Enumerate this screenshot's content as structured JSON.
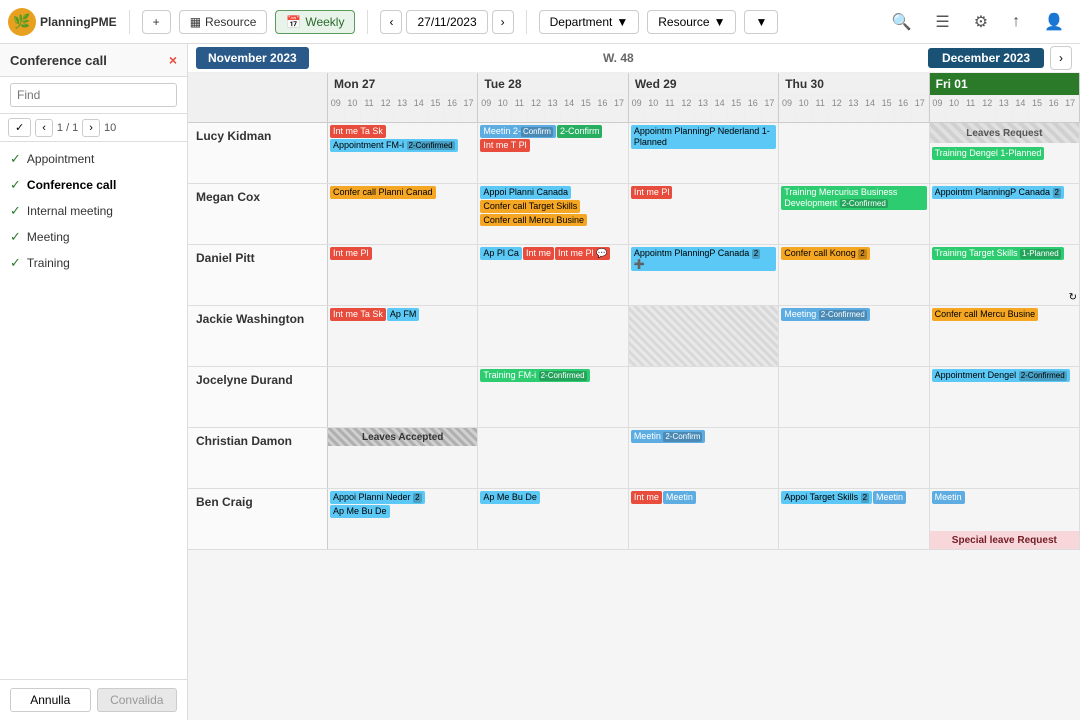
{
  "app": {
    "logo_text": "PlanningPME",
    "logo_icon": "🌿"
  },
  "toolbar": {
    "add_label": "+",
    "resource_label": "Resource",
    "weekly_label": "Weekly",
    "date_value": "27/11/2023",
    "department_label": "Department",
    "resource_filter_label": "Resource",
    "filter_icon": "▼",
    "search_icon": "🔍",
    "layers_icon": "☰",
    "settings_icon": "⚙",
    "share_icon": "↑",
    "user_icon": "👤"
  },
  "sidebar": {
    "title": "Conference call",
    "close_icon": "×",
    "find_placeholder": "Find",
    "nav_prev": "‹",
    "nav_next": "›",
    "nav_info": "1 / 1",
    "nav_max": "10",
    "filters": [
      {
        "id": "appointment",
        "label": "Appointment",
        "checked": true
      },
      {
        "id": "conference-call",
        "label": "Conference call",
        "checked": true,
        "active": true
      },
      {
        "id": "internal-meeting",
        "label": "Internal meeting",
        "checked": true
      },
      {
        "id": "meeting",
        "label": "Meeting",
        "checked": true
      },
      {
        "id": "training",
        "label": "Training",
        "checked": true
      }
    ],
    "btn_annulla": "Annulla",
    "btn_convalida": "Convalida"
  },
  "calendar": {
    "month_title": "November 2023",
    "week_label": "W. 48",
    "next_month_label": "December 2023",
    "days": [
      {
        "label": "Mon 27",
        "short": "Mon",
        "date": "27"
      },
      {
        "label": "Tue 28",
        "short": "Tue",
        "date": "28"
      },
      {
        "label": "Wed 29",
        "short": "Wed",
        "date": "29"
      },
      {
        "label": "Thu 30",
        "short": "Thu",
        "date": "30"
      },
      {
        "label": "Fri 01",
        "short": "Fri",
        "date": "01",
        "today": true
      }
    ],
    "time_slots": [
      "09",
      "10",
      "11",
      "12",
      "13",
      "14",
      "15",
      "16",
      "17"
    ],
    "resources": [
      {
        "name": "Lucy Kidman",
        "events": {
          "mon": [
            {
              "type": "internal",
              "label": "Int me Ta Sk"
            },
            {
              "type": "appointment",
              "label": "Appointment FM-i 2-Confirmed"
            }
          ],
          "tue": [
            {
              "type": "internal",
              "label": "Int me T Pl"
            }
          ],
          "wed": [],
          "thu": [],
          "fri": [
            {
              "type": "leave",
              "label": "Leaves Request"
            }
          ]
        }
      },
      {
        "name": "Megan Cox",
        "events": {
          "mon": [
            {
              "type": "conference",
              "label": "Confer call Planni Canad"
            }
          ],
          "tue": [
            {
              "type": "appointment",
              "label": "Appoi Planni Canada"
            },
            {
              "type": "conference",
              "label": "Confer call Target Skills"
            },
            {
              "type": "conference",
              "label": "Confer call Mercu Busine"
            }
          ],
          "wed": [
            {
              "type": "internal",
              "label": "Int me Pl"
            }
          ],
          "thu": [
            {
              "type": "training",
              "label": "Training Mercurius Business Development 2-Confirmed"
            }
          ],
          "fri": [
            {
              "type": "appointment",
              "label": "Appointm PlanningP Canada 2"
            }
          ]
        }
      },
      {
        "name": "Daniel Pitt",
        "events": {
          "mon": [],
          "tue": [
            {
              "type": "appointment",
              "label": "Ap Pl Ca"
            },
            {
              "type": "internal",
              "label": "Int me"
            },
            {
              "type": "internal",
              "label": "Int me Pl"
            }
          ],
          "wed": [
            {
              "type": "appointment",
              "label": "Appointm PlanningP Canada 2"
            }
          ],
          "thu": [
            {
              "type": "conference",
              "label": "Confer call Konog 2"
            }
          ],
          "fri": [
            {
              "type": "training",
              "label": "Training Target Skills 1-Planned"
            }
          ]
        }
      },
      {
        "name": "Jackie Washington",
        "events": {
          "mon": [
            {
              "type": "internal",
              "label": "Int me Ta Sk"
            },
            {
              "type": "appointment",
              "label": "Ap FM"
            }
          ],
          "tue": [],
          "wed": [
            {
              "type": "leave",
              "label": ""
            }
          ],
          "thu": [
            {
              "type": "meeting",
              "label": "Meeting 2-Confirmed"
            }
          ],
          "fri": [
            {
              "type": "conference",
              "label": "Confer call Mercu Busine"
            }
          ]
        }
      },
      {
        "name": "Jocelyne Durand",
        "events": {
          "mon": [],
          "tue": [
            {
              "type": "training",
              "label": "Training FM-i 2-Confirmed"
            }
          ],
          "wed": [],
          "thu": [],
          "fri": [
            {
              "type": "appointment",
              "label": "Appointment Dengel 2-Confirmed"
            }
          ]
        }
      },
      {
        "name": "Christian Damon",
        "events": {
          "mon": [
            {
              "type": "leaves-accepted",
              "label": "Leaves Accepted"
            }
          ],
          "tue": [],
          "wed": [
            {
              "type": "meeting",
              "label": "Meetin 2-Confirm"
            }
          ],
          "thu": [],
          "fri": []
        }
      },
      {
        "name": "Ben Craig",
        "events": {
          "mon": [
            {
              "type": "appointment",
              "label": "Appoi Planni Neder 2"
            },
            {
              "type": "appointment",
              "label": "Ap Me Bu De"
            }
          ],
          "tue": [
            {
              "type": "appointment",
              "label": "Ap Me Bu De"
            }
          ],
          "wed": [],
          "thu": [
            {
              "type": "appointment",
              "label": "Appoi Target Skills 2"
            },
            {
              "type": "meeting",
              "label": "Meetin"
            }
          ],
          "fri": [
            {
              "type": "meeting",
              "label": "Meetin"
            },
            {
              "type": "special-leave",
              "label": "Special leave Request"
            }
          ]
        }
      }
    ]
  }
}
